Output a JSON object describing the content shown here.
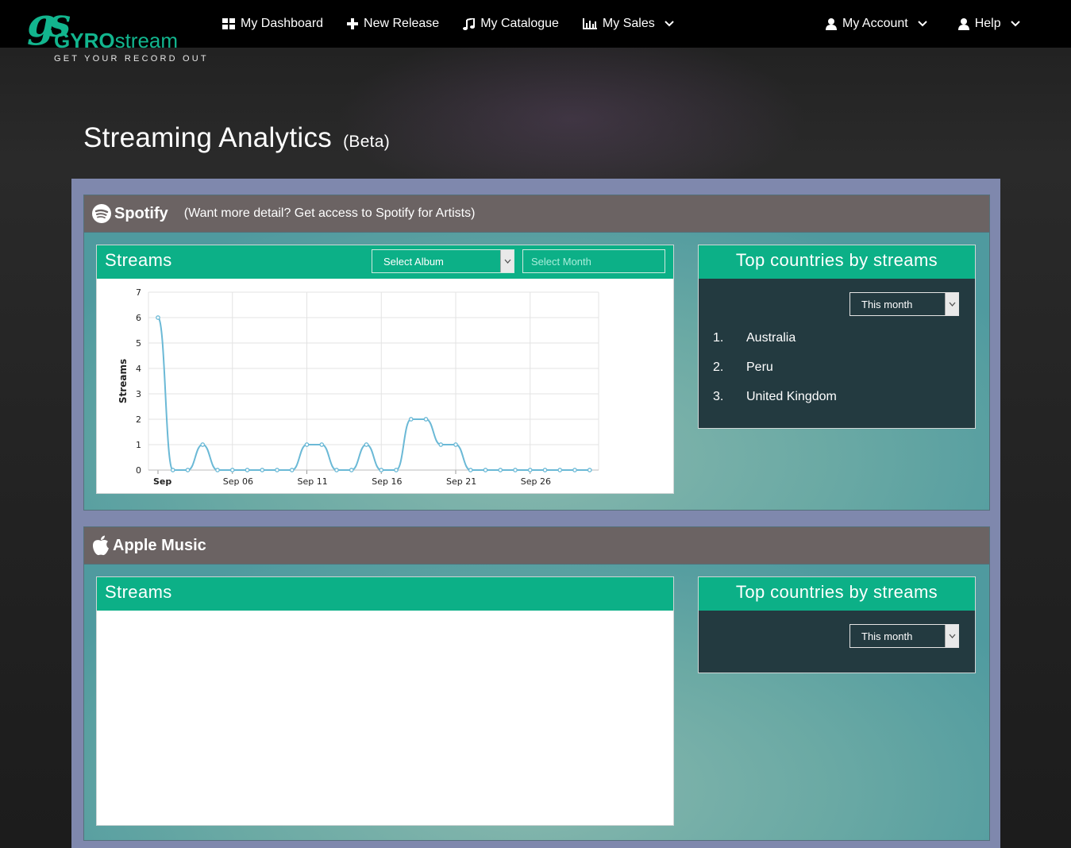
{
  "brand": {
    "logo_mark": "gs",
    "name_bold": "GYRO",
    "name_light": "stream",
    "tagline": "GET YOUR RECORD OUT"
  },
  "nav": {
    "dashboard": "My Dashboard",
    "new_release": "New Release",
    "catalogue": "My Catalogue",
    "sales": "My Sales",
    "account": "My Account",
    "help": "Help"
  },
  "page": {
    "title": "Streaming Analytics",
    "title_suffix": "(Beta)"
  },
  "spotify": {
    "name": "Spotify",
    "note": "(Want more detail? Get access to Spotify for Artists)",
    "streams_title": "Streams",
    "album_select": "Select Album",
    "month_placeholder": "Select Month",
    "countries_title": "Top countries by streams",
    "period_select": "This month",
    "countries": [
      {
        "rank": "1.",
        "name": "Australia"
      },
      {
        "rank": "2.",
        "name": "Peru"
      },
      {
        "rank": "3.",
        "name": "United Kingdom"
      }
    ]
  },
  "apple": {
    "name": "Apple Music",
    "streams_title": "Streams",
    "countries_title": "Top countries by streams",
    "period_select": "This month"
  },
  "colors": {
    "accent": "#0cb087",
    "line": "#6bb9d6",
    "panel": "#7f88ad",
    "section_head": "#6b6363",
    "dark_card": "#233a40"
  },
  "chart_data": {
    "type": "line",
    "title": "",
    "xlabel": "",
    "ylabel": "Streams",
    "ylim": [
      0,
      7
    ],
    "yticks": [
      "0",
      "1",
      "2",
      "3",
      "4",
      "5",
      "6",
      "7"
    ],
    "xticks": [
      {
        "day": 1,
        "label": "Sep"
      },
      {
        "day": 6,
        "label": "Sep 06"
      },
      {
        "day": 11,
        "label": "Sep 11"
      },
      {
        "day": 16,
        "label": "Sep 16"
      },
      {
        "day": 21,
        "label": "Sep 21"
      },
      {
        "day": 26,
        "label": "Sep 26"
      }
    ],
    "x": [
      1,
      2,
      3,
      4,
      5,
      6,
      7,
      8,
      9,
      10,
      11,
      12,
      13,
      14,
      15,
      16,
      17,
      18,
      19,
      20,
      21,
      22,
      23,
      24,
      25,
      26,
      27,
      28,
      29,
      30
    ],
    "series": [
      {
        "values": [
          6,
          0,
          0,
          1,
          0,
          0,
          0,
          0,
          0,
          0,
          1,
          1,
          0,
          0,
          1,
          0,
          0,
          2,
          2,
          1,
          1,
          0,
          0,
          0,
          0,
          0,
          0,
          0,
          0,
          0
        ]
      }
    ],
    "grid": true,
    "legend": "none"
  }
}
